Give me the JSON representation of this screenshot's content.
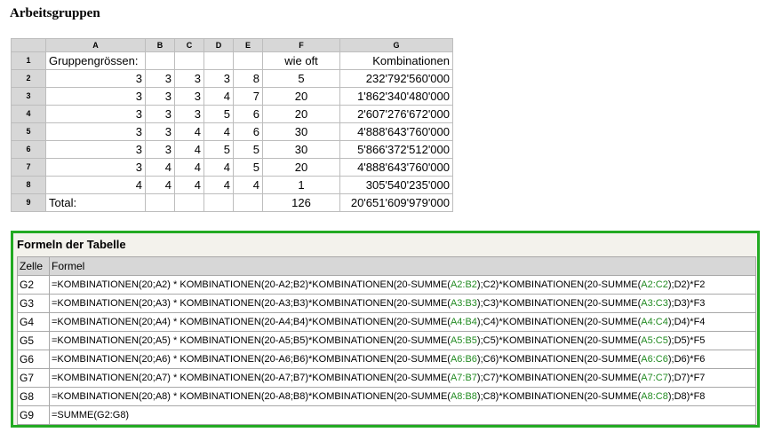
{
  "page_title": "Arbeitsgruppen",
  "sheet": {
    "columns": [
      "A",
      "B",
      "C",
      "D",
      "E",
      "F",
      "G"
    ],
    "rows": [
      {
        "n": "1",
        "a": "Gruppengrössen:",
        "b": "",
        "c": "",
        "d": "",
        "e": "",
        "f": "wie oft",
        "g": "Kombinationen"
      },
      {
        "n": "2",
        "a": "3",
        "b": "3",
        "c": "3",
        "d": "3",
        "e": "8",
        "f": "5",
        "g": "232'792'560'000"
      },
      {
        "n": "3",
        "a": "3",
        "b": "3",
        "c": "3",
        "d": "4",
        "e": "7",
        "f": "20",
        "g": "1'862'340'480'000"
      },
      {
        "n": "4",
        "a": "3",
        "b": "3",
        "c": "3",
        "d": "5",
        "e": "6",
        "f": "20",
        "g": "2'607'276'672'000"
      },
      {
        "n": "5",
        "a": "3",
        "b": "3",
        "c": "4",
        "d": "4",
        "e": "6",
        "f": "30",
        "g": "4'888'643'760'000"
      },
      {
        "n": "6",
        "a": "3",
        "b": "3",
        "c": "4",
        "d": "5",
        "e": "5",
        "f": "30",
        "g": "5'866'372'512'000"
      },
      {
        "n": "7",
        "a": "3",
        "b": "4",
        "c": "4",
        "d": "4",
        "e": "5",
        "f": "20",
        "g": "4'888'643'760'000"
      },
      {
        "n": "8",
        "a": "4",
        "b": "4",
        "c": "4",
        "d": "4",
        "e": "4",
        "f": "1",
        "g": "305'540'235'000"
      },
      {
        "n": "9",
        "a": "Total:",
        "b": "",
        "c": "",
        "d": "",
        "e": "",
        "f": "126",
        "g": "20'651'609'979'000"
      }
    ]
  },
  "formulas": {
    "title": "Formeln der Tabelle",
    "header": {
      "cell": "Zelle",
      "formula": "Formel"
    },
    "rows": [
      {
        "cell": "G2",
        "p1": "=KOMBINATIONEN(20;A2) * KOMBINATIONEN(20-A2;B2)*KOMBINATIONEN(20-SUMME(",
        "r1": "A2:B2",
        "p2": ");C2)*KOMBINATIONEN(20-SUMME(",
        "r2": "A2:C2",
        "p3": ");D2)*F2"
      },
      {
        "cell": "G3",
        "p1": "=KOMBINATIONEN(20;A3) * KOMBINATIONEN(20-A3;B3)*KOMBINATIONEN(20-SUMME(",
        "r1": "A3:B3",
        "p2": ");C3)*KOMBINATIONEN(20-SUMME(",
        "r2": "A3:C3",
        "p3": ");D3)*F3"
      },
      {
        "cell": "G4",
        "p1": "=KOMBINATIONEN(20;A4) * KOMBINATIONEN(20-A4;B4)*KOMBINATIONEN(20-SUMME(",
        "r1": "A4:B4",
        "p2": ");C4)*KOMBINATIONEN(20-SUMME(",
        "r2": "A4:C4",
        "p3": ");D4)*F4"
      },
      {
        "cell": "G5",
        "p1": "=KOMBINATIONEN(20;A5) * KOMBINATIONEN(20-A5;B5)*KOMBINATIONEN(20-SUMME(",
        "r1": "A5:B5",
        "p2": ");C5)*KOMBINATIONEN(20-SUMME(",
        "r2": "A5:C5",
        "p3": ");D5)*F5"
      },
      {
        "cell": "G6",
        "p1": "=KOMBINATIONEN(20;A6) * KOMBINATIONEN(20-A6;B6)*KOMBINATIONEN(20-SUMME(",
        "r1": "A6:B6",
        "p2": ");C6)*KOMBINATIONEN(20-SUMME(",
        "r2": "A6:C6",
        "p3": ");D6)*F6"
      },
      {
        "cell": "G7",
        "p1": "=KOMBINATIONEN(20;A7) * KOMBINATIONEN(20-A7;B7)*KOMBINATIONEN(20-SUMME(",
        "r1": "A7:B7",
        "p2": ");C7)*KOMBINATIONEN(20-SUMME(",
        "r2": "A7:C7",
        "p3": ");D7)*F7"
      },
      {
        "cell": "G8",
        "p1": "=KOMBINATIONEN(20;A8) * KOMBINATIONEN(20-A8;B8)*KOMBINATIONEN(20-SUMME(",
        "r1": "A8:B8",
        "p2": ");C8)*KOMBINATIONEN(20-SUMME(",
        "r2": "A8:C8",
        "p3": ");D8)*F8"
      },
      {
        "cell": "G9",
        "p1": "=SUMME(G2:G8)",
        "r1": "",
        "p2": "",
        "r2": "",
        "p3": ""
      }
    ]
  },
  "colors": {
    "frame": "#22aa22",
    "reference": "#228b22",
    "header_bg": "#d7d7d7"
  }
}
